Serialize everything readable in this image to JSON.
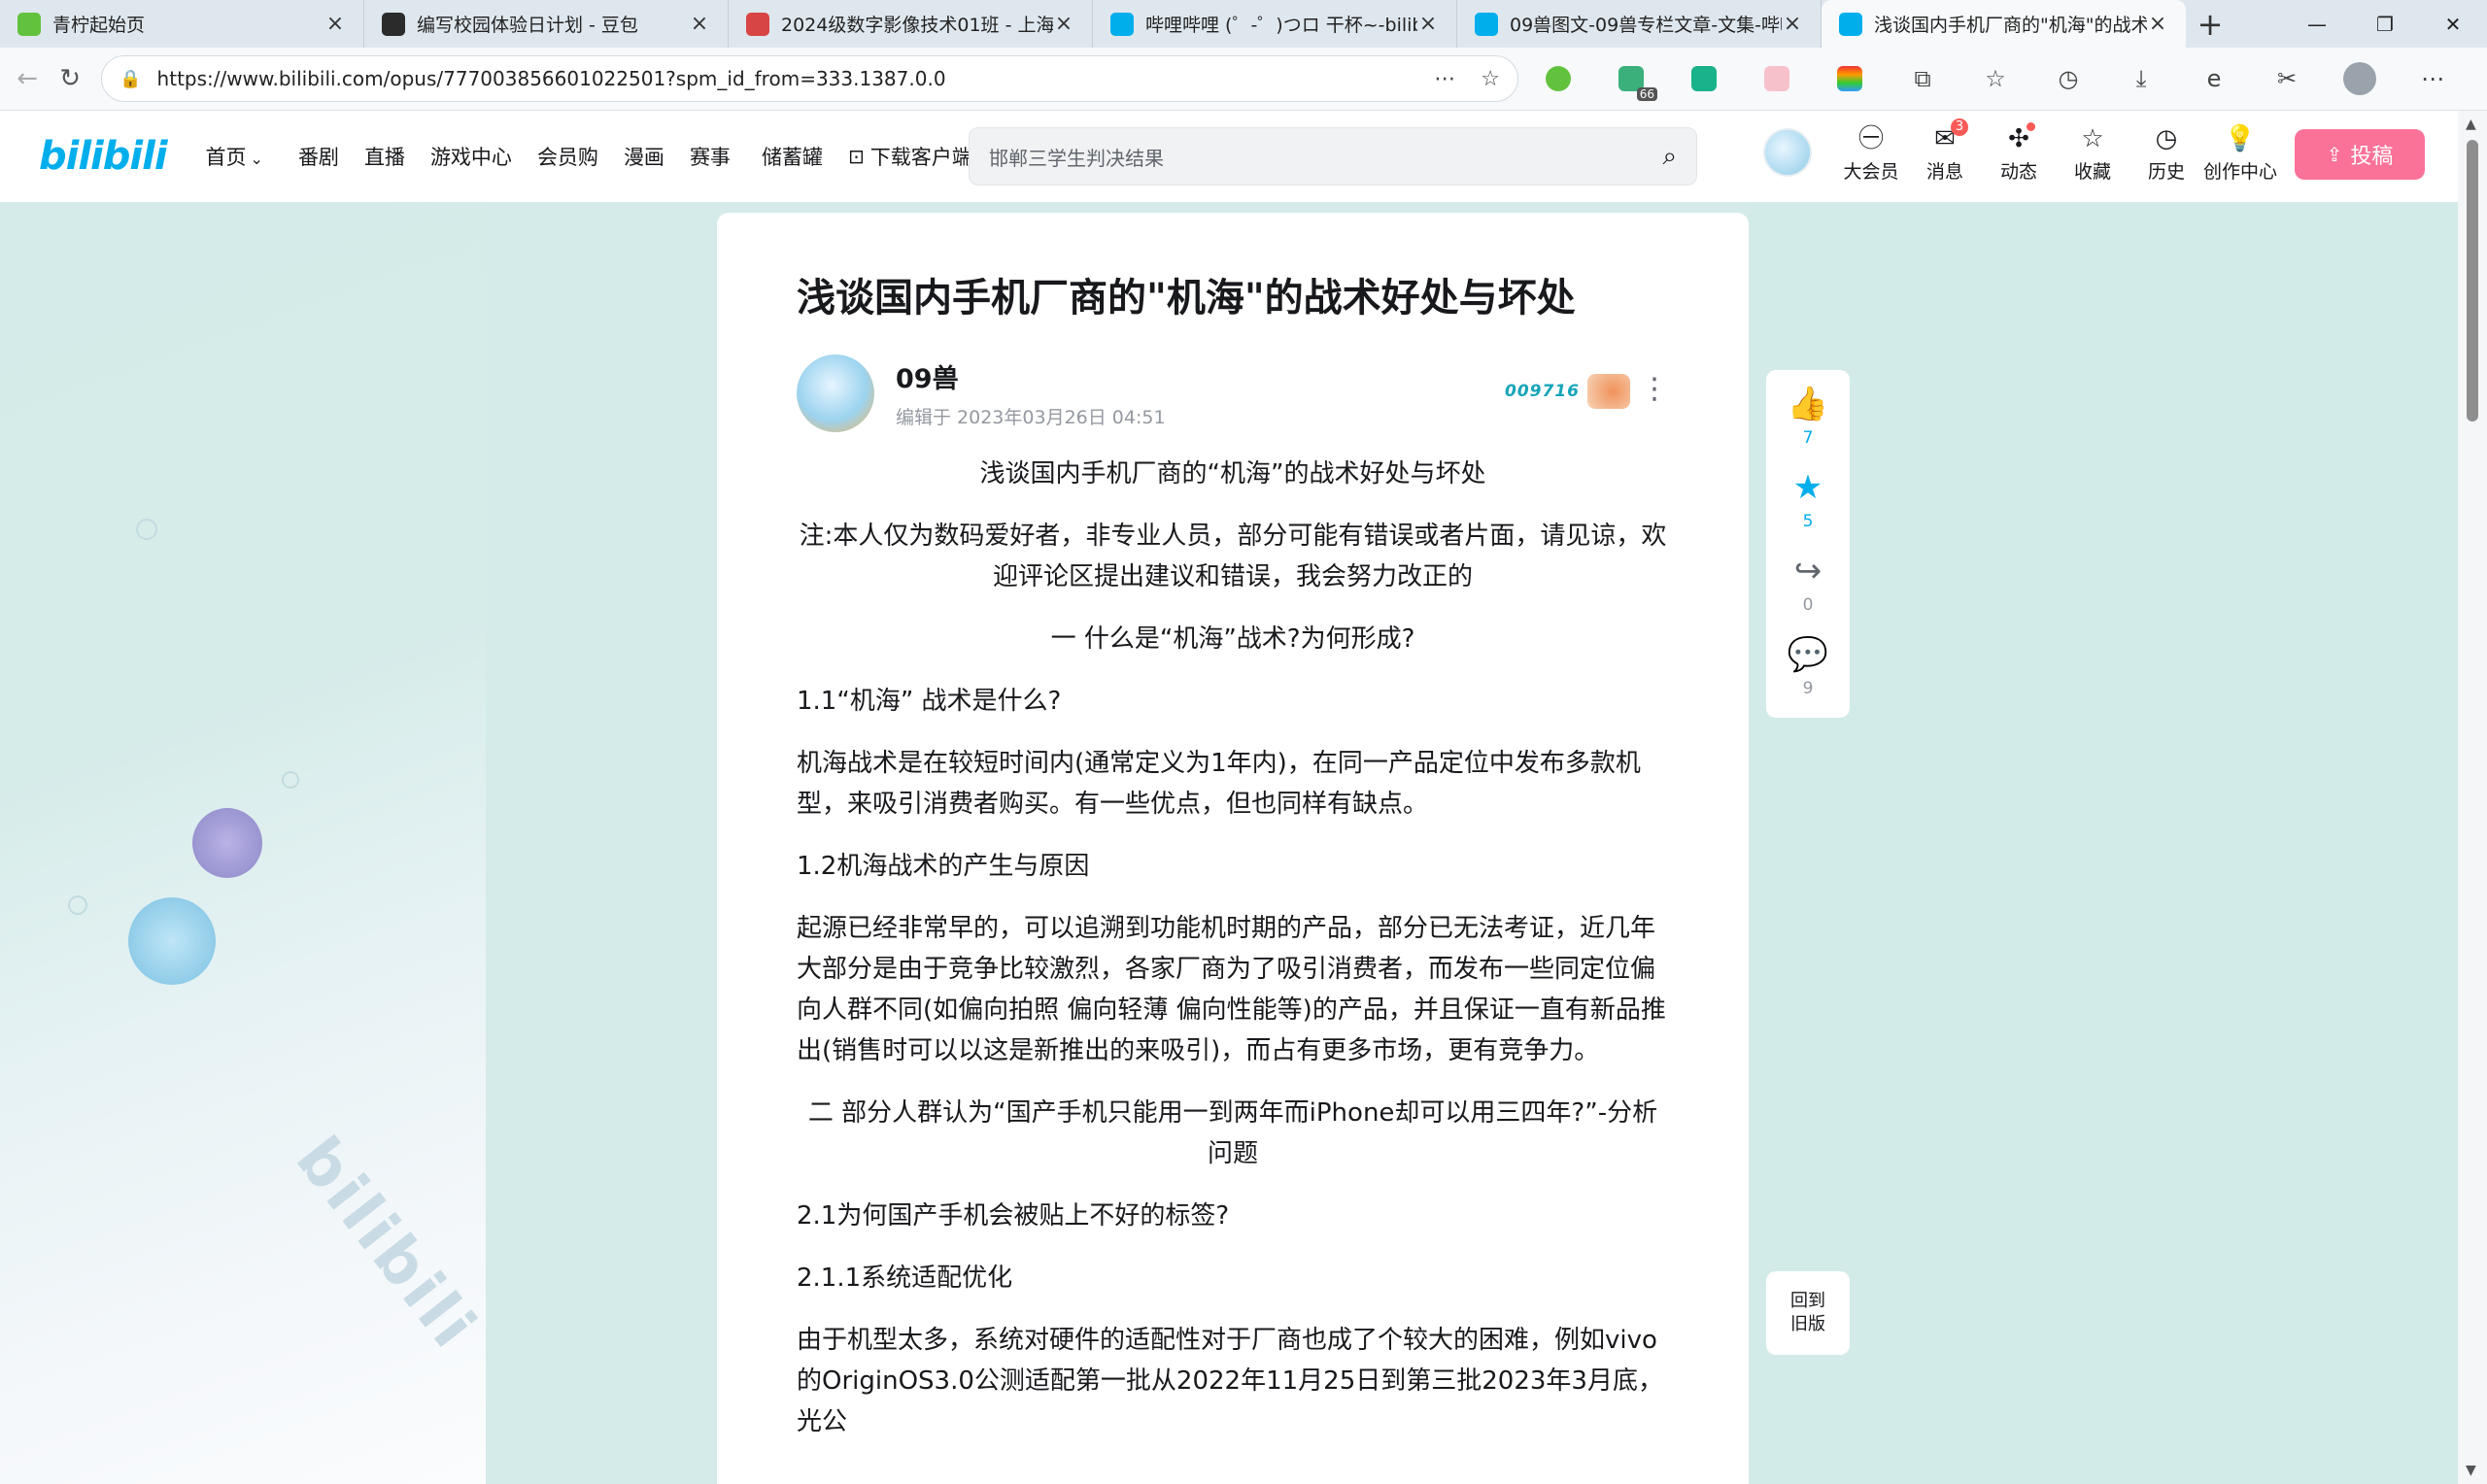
{
  "browser": {
    "tabs": [
      {
        "title": "青柠起始页",
        "icon_color": "#62c23e",
        "active": false
      },
      {
        "title": "编写校园体验日计划 - 豆包",
        "icon_color": "#2b2b2b",
        "active": false
      },
      {
        "title": "2024级数字影像技术01班 - 上海市",
        "icon_color": "#d84545",
        "active": false
      },
      {
        "title": "哔哩哔哩 (゜-゜)つロ 干杯~-bilibili",
        "icon_color": "#00aeec",
        "active": false
      },
      {
        "title": "09兽图文-09兽专栏文章-文集-哔哩",
        "icon_color": "#00aeec",
        "active": false
      },
      {
        "title": "浅谈国内手机厂商的\"机海\"的战术",
        "icon_color": "#00aeec",
        "active": true
      }
    ],
    "url": "https://www.bilibili.com/opus/777003856601022501?spm_id_from=333.1387.0.0",
    "ext_badge": "66"
  },
  "header": {
    "logo": "bilibili",
    "nav": [
      "首页",
      "番剧",
      "直播",
      "游戏中心",
      "会员购",
      "漫画",
      "赛事",
      "储蓄罐",
      "下载客户端"
    ],
    "search_placeholder": "邯郸三学生判决结果",
    "icons": [
      {
        "label": "大会员",
        "icon": "vip-icon",
        "glyph": "㊀"
      },
      {
        "label": "消息",
        "icon": "message-icon",
        "glyph": "✉",
        "badge": "3"
      },
      {
        "label": "动态",
        "icon": "dynamic-icon",
        "glyph": "✣",
        "dot": true
      },
      {
        "label": "收藏",
        "icon": "favorite-icon",
        "glyph": "☆"
      },
      {
        "label": "历史",
        "icon": "history-icon",
        "glyph": "◷"
      },
      {
        "label": "创作中心",
        "icon": "creator-icon",
        "glyph": "💡"
      }
    ],
    "upload": "投稿"
  },
  "article": {
    "title": "浅谈国内手机厂商的\"机海\"的战术好处与坏处",
    "author": "09兽",
    "edited": "编辑于 2023年03月26日 04:51",
    "fan_number": "009716",
    "paragraphs": [
      {
        "text": "浅谈国内手机厂商的“机海”的战术好处与坏处",
        "center": true
      },
      {
        "text": "注:本人仅为数码爱好者，非专业人员，部分可能有错误或者片面，请见谅，欢迎评论区提出建议和错误，我会努力改正的",
        "center": true
      },
      {
        "text": "一 什么是“机海”战术?为何形成?",
        "center": true
      },
      {
        "text": "1.1“机海” 战术是什么?",
        "center": false
      },
      {
        "text": "机海战术是在较短时间内(通常定义为1年内)，在同一产品定位中发布多款机型，来吸引消费者购买。有一些优点，但也同样有缺点。",
        "center": false
      },
      {
        "text": "1.2机海战术的产生与原因",
        "center": false
      },
      {
        "text": "起源已经非常早的，可以追溯到功能机时期的产品，部分已无法考证，近几年大部分是由于竞争比较激烈，各家厂商为了吸引消费者，而发布一些同定位偏向人群不同(如偏向拍照 偏向轻薄 偏向性能等)的产品，并且保证一直有新品推出(销售时可以以这是新推出的来吸引)，而占有更多市场，更有竞争力。",
        "center": false
      },
      {
        "text": "二 部分人群认为“国产手机只能用一到两年而iPhone却可以用三四年?”-分析问题",
        "center": true
      },
      {
        "text": "2.1为何国产手机会被贴上不好的标签?",
        "center": false
      },
      {
        "text": "2.1.1系统适配优化",
        "center": false
      },
      {
        "text": "由于机型太多，系统对硬件的适配性对于厂商也成了个较大的困难，例如vivo的OriginOS3.0公测适配第一批从2022年11月25日到第三批2023年3月底，光公",
        "center": false
      }
    ]
  },
  "actions": [
    {
      "name": "like",
      "glyph": "👍",
      "count": "7",
      "style": "blue"
    },
    {
      "name": "favorite",
      "glyph": "★",
      "count": "5",
      "style": "blue"
    },
    {
      "name": "share",
      "glyph": "↪",
      "count": "0",
      "style": "grey"
    },
    {
      "name": "comment",
      "glyph": "💬",
      "count": "9",
      "style": "grey"
    }
  ],
  "old_version": {
    "line1": "回到",
    "line2": "旧版"
  }
}
